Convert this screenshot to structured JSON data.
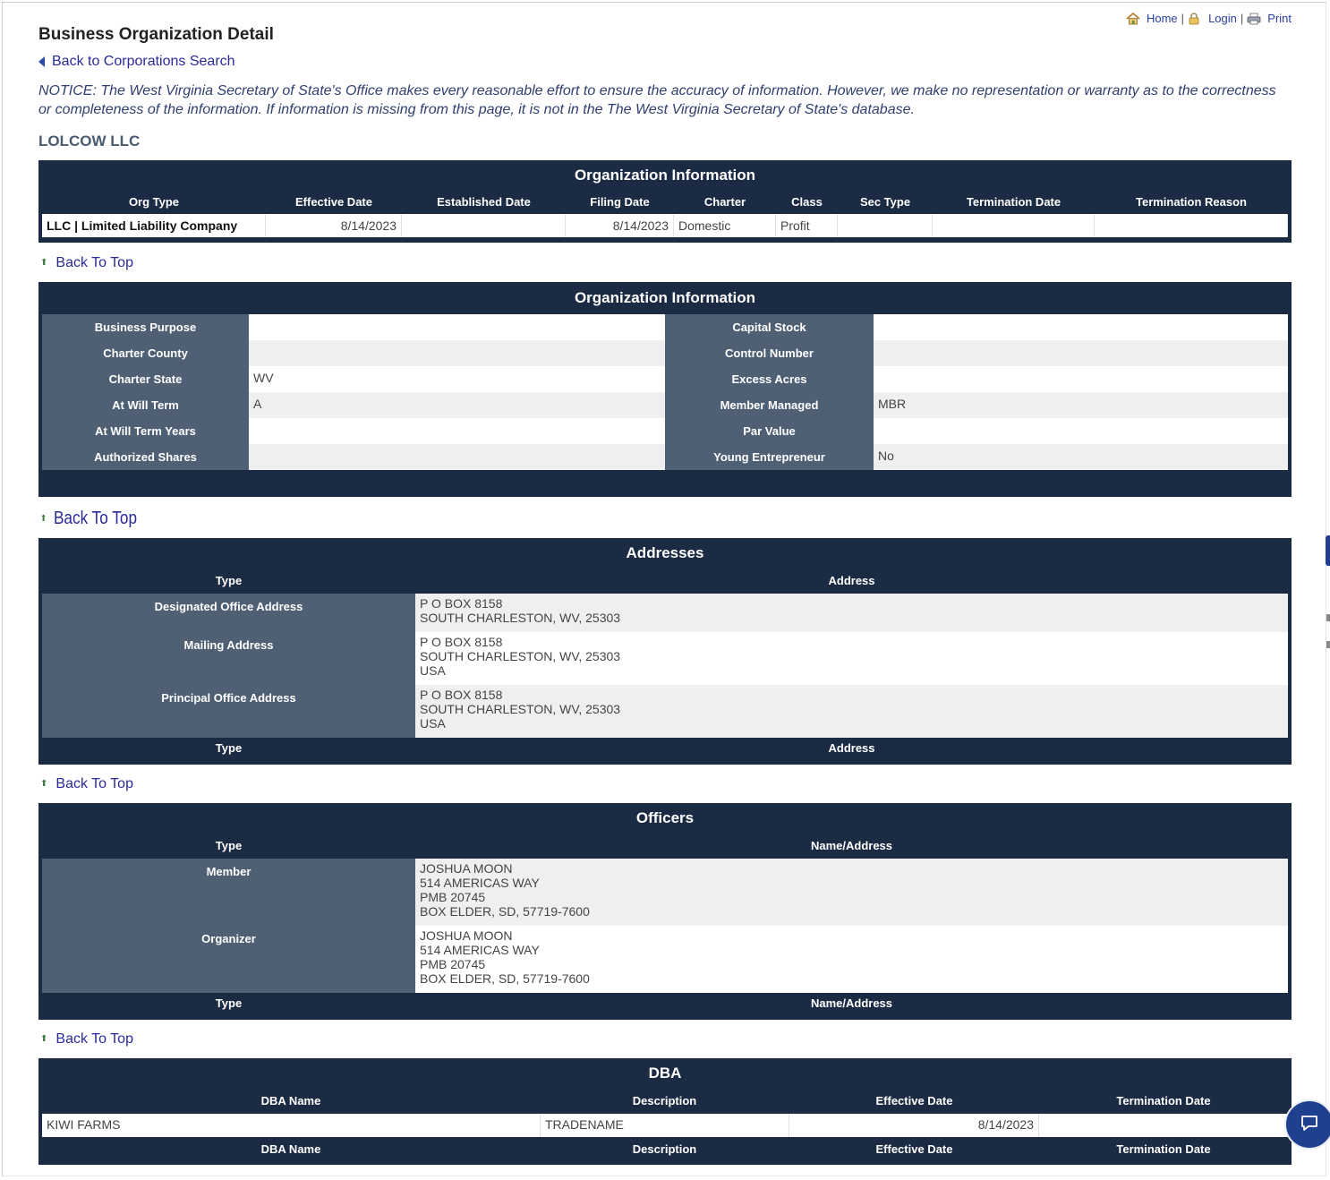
{
  "toplinks": {
    "home": "Home",
    "login": "Login",
    "print": "Print",
    "sep": "|"
  },
  "page": {
    "title": "Business Organization Detail",
    "back_search": "Back to Corporations Search",
    "notice": "NOTICE: The West Virginia Secretary of State's Office makes every reasonable effort to ensure the accuracy of information. However, we make no representation or warranty as to the correctness or completeness of the information. If information is missing from this page, it is not in the The West Virginia Secretary of State's database.",
    "org_name": "LOLCOW LLC",
    "back_to_top": "Back To Top"
  },
  "org_info": {
    "title": "Organization Information",
    "headers": [
      "Org Type",
      "Effective Date",
      "Established Date",
      "Filing Date",
      "Charter",
      "Class",
      "Sec Type",
      "Termination Date",
      "Termination Reason"
    ],
    "row": [
      "LLC | Limited Liability Company",
      "8/14/2023",
      "",
      "8/14/2023",
      "Domestic",
      "Profit",
      "",
      "",
      ""
    ]
  },
  "org_info2": {
    "title": "Organization Information",
    "rows": [
      {
        "k1": "Business Purpose",
        "v1": "",
        "k2": "Capital Stock",
        "v2": ""
      },
      {
        "k1": "Charter County",
        "v1": "",
        "k2": "Control Number",
        "v2": ""
      },
      {
        "k1": "Charter State",
        "v1": "WV",
        "k2": "Excess Acres",
        "v2": ""
      },
      {
        "k1": "At Will Term",
        "v1": "A",
        "k2": "Member Managed",
        "v2": "MBR"
      },
      {
        "k1": "At Will Term Years",
        "v1": "",
        "k2": "Par Value",
        "v2": ""
      },
      {
        "k1": "Authorized Shares",
        "v1": "",
        "k2": "Young Entrepreneur",
        "v2": "No"
      }
    ]
  },
  "addresses": {
    "title": "Addresses",
    "col_type": "Type",
    "col_address": "Address",
    "rows": [
      {
        "type": "Designated Office Address",
        "lines": [
          "P O BOX 8158",
          "SOUTH CHARLESTON, WV, 25303"
        ]
      },
      {
        "type": "Mailing Address",
        "lines": [
          "P O BOX 8158",
          "SOUTH CHARLESTON, WV, 25303",
          "USA"
        ]
      },
      {
        "type": "Principal Office Address",
        "lines": [
          "P O BOX 8158",
          "SOUTH CHARLESTON, WV, 25303",
          "USA"
        ]
      }
    ]
  },
  "officers": {
    "title": "Officers",
    "col_type": "Type",
    "col_name": "Name/Address",
    "rows": [
      {
        "type": "Member",
        "lines": [
          "JOSHUA MOON",
          "514 AMERICAS WAY",
          "PMB 20745",
          "BOX ELDER, SD, 57719-7600"
        ]
      },
      {
        "type": "Organizer",
        "lines": [
          "JOSHUA MOON",
          "514 AMERICAS WAY",
          "PMB 20745",
          "BOX ELDER, SD, 57719-7600"
        ]
      }
    ]
  },
  "dba": {
    "title": "DBA",
    "headers": [
      "DBA Name",
      "Description",
      "Effective Date",
      "Termination Date"
    ],
    "row": [
      "KIWI FARMS",
      "TRADENAME",
      "8/14/2023",
      ""
    ]
  },
  "colors": {
    "panel": "#1c2b44",
    "label_cell": "#4f6075",
    "link": "#2a2a9a"
  }
}
